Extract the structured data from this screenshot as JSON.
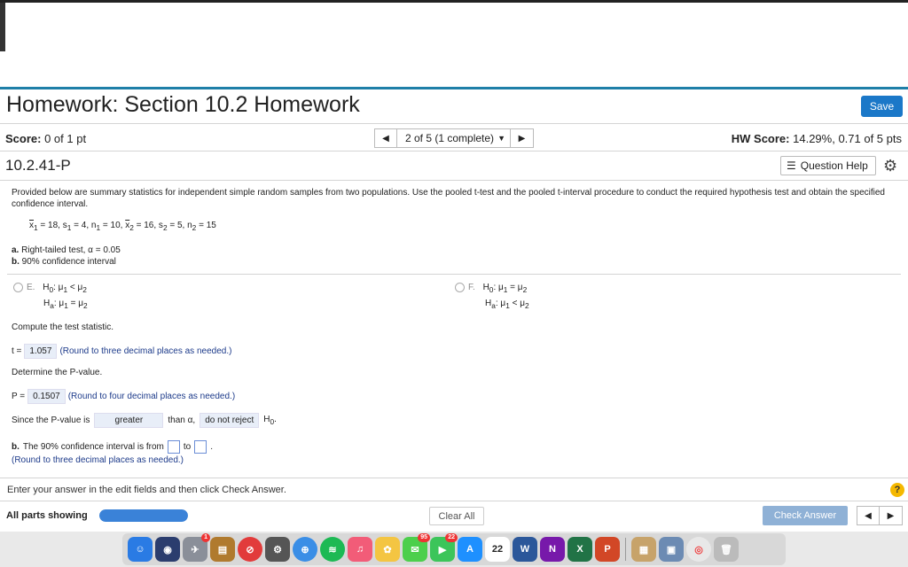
{
  "header": {
    "title": "Homework: Section 10.2 Homework",
    "save_label": "Save"
  },
  "score_bar": {
    "score_label": "Score:",
    "score_value": "0 of 1 pt",
    "question_select": "2 of 5 (1 complete)",
    "hw_score_label": "HW Score:",
    "hw_score_value": "14.29%, 0.71 of 5 pts"
  },
  "question": {
    "id": "10.2.41-P",
    "help_label": "Question Help",
    "prompt": "Provided below are summary statistics for independent simple random samples from two populations. Use the pooled t-test and the pooled t-interval procedure to conduct the required hypothesis test and obtain the specified confidence interval.",
    "stats": {
      "x1": "18",
      "s1": "4",
      "n1": "10",
      "x2": "16",
      "s2": "5",
      "n2": "15"
    },
    "part_a_label": "a.",
    "part_a_text": "Right-tailed test, α = 0.05",
    "part_b_label": "b.",
    "part_b_text": "90% confidence interval",
    "option_e": {
      "letter": "E."
    },
    "option_f": {
      "letter": "F."
    },
    "compute_text": "Compute the test statistic.",
    "t_prefix": "t =",
    "t_value": "1.057",
    "t_hint": "(Round to three decimal places as needed.)",
    "determine_text": "Determine the P-value.",
    "p_prefix": "P =",
    "p_value": "0.1507",
    "p_hint": "(Round to four decimal places as needed.)",
    "since_prefix": "Since the P-value is",
    "since_comparison": "greater",
    "since_middle": "than α,",
    "since_decision": "do not reject",
    "ci_label": "b.",
    "ci_text": "The 90% confidence interval is from",
    "ci_to": "to",
    "ci_hint": "(Round to three decimal places as needed.)"
  },
  "footer": {
    "instructions": "Enter your answer in the edit fields and then click Check Answer.",
    "help_icon_label": "?",
    "all_parts_label": "All parts showing",
    "progress_fraction": 1.0,
    "clear_all_label": "Clear All",
    "check_answer_label": "Check Answer"
  },
  "dock": {
    "calendar_day": "22",
    "badges": {
      "launchpad": "1",
      "messages": "95",
      "facetime": "22"
    },
    "colors": {
      "accent": "#1f7fa8",
      "save": "#1b78c8",
      "check_answer": "#8fb1d6",
      "hint": "#1c3a8a"
    }
  }
}
